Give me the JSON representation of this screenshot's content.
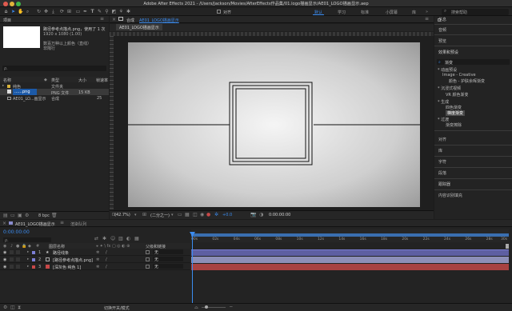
{
  "window_title": "Adobe After Effects 2021 - /Users/Jackson/Movies/AfterEffects作品集/01.logo描画显示/AE01_LOGO描画显示.aep",
  "toolbar": {
    "align_label": "对齐",
    "workspaces": [
      "默认",
      "学习",
      "标准",
      "小屏幕",
      "库"
    ],
    "active_workspace": "默认",
    "search_placeholder": "搜索帮助"
  },
  "project_panel": {
    "title": "项目",
    "item_name": "路径参考点描点.png",
    "usage": "，使用了 1 次",
    "dimensions": "1920 x 1080 (1.00)",
    "color_info": "数百万种以上颜色（直线）",
    "interp": "非隔行",
    "search_placeholder": "ρ.",
    "columns": [
      "名称",
      "类型",
      "大小",
      "帧速率"
    ],
    "rows": [
      {
        "name": "纯色",
        "type": "文件夹",
        "size": "",
        "fps": "",
        "color": "#e0c23a",
        "icon": "folder-icon"
      },
      {
        "name": "……png",
        "type": "PNG 文件",
        "size": "15 KB",
        "fps": "",
        "color": "#e0c23a",
        "icon": "image-icon"
      },
      {
        "name": "AE01_LO...画显示",
        "type": "合成",
        "size": "",
        "fps": "25",
        "color": "#8a8ccf",
        "icon": "composition-icon"
      }
    ],
    "bpc": "8 bpc"
  },
  "composition_panel": {
    "tab_prefix": "合成",
    "tab_name": "AE01_LOGO描画显示",
    "sub_tab": "AE01_LOGO描画显示",
    "zoom": "(42.7%)",
    "resolution": "(二分之一)",
    "exposure": "+0.0",
    "timecode": "0:00:00:00"
  },
  "right_panel": {
    "search_placeholder": "搜索帮助",
    "sections_top": [
      "信息",
      "音频",
      "预览",
      "效果和预设"
    ],
    "effects_search_value": "渐变",
    "effects_tree": [
      {
        "label": "* 动画预设",
        "level": 0
      },
      {
        "label": "Image - Creative",
        "level": 1
      },
      {
        "label": "颜色 - 护肤余晖渐变",
        "level": 2
      },
      {
        "label": "* 沉浸式视频",
        "level": 0
      },
      {
        "label": "VR 颜色渐变",
        "level": 1
      },
      {
        "label": "* 生成",
        "level": 0
      },
      {
        "label": "四色渐变",
        "level": 1
      },
      {
        "label": "梯度渐变",
        "level": 1
      },
      {
        "label": "* 过渡",
        "level": 0
      },
      {
        "label": "渐变擦除",
        "level": 1
      }
    ],
    "sections_bottom": [
      "对齐",
      "库",
      "字符",
      "段落",
      "跟踪器",
      "内容识别填充"
    ]
  },
  "timeline": {
    "tab_name": "AE01_LOGO描画显示",
    "render_queue": "渲染队列",
    "timecode": "0:00:00:00",
    "search_placeholder": "ρ.",
    "col_source": "图层名称",
    "col_parent": "父级和链接",
    "layers": [
      {
        "num": "1",
        "name": "路径线条",
        "parent": "无",
        "color": "#7c7fd6",
        "bar": "#6e6fb0"
      },
      {
        "num": "2",
        "name": "[路径参考点描点.png]",
        "parent": "无",
        "color": "#7c7fd6",
        "bar": "#8a8cb8"
      },
      {
        "num": "3",
        "name": "[深灰色 纯色 1]",
        "parent": "无",
        "color": "#c84848",
        "bar": "#b24444"
      }
    ],
    "ruler": [
      "00s",
      "02s",
      "04s",
      "06s",
      "08s",
      "10s",
      "12s",
      "14s",
      "16s",
      "18s",
      "20s",
      "22s",
      "24s",
      "26s",
      "28s",
      "30s"
    ],
    "footer_label": "切换开关/模式"
  }
}
